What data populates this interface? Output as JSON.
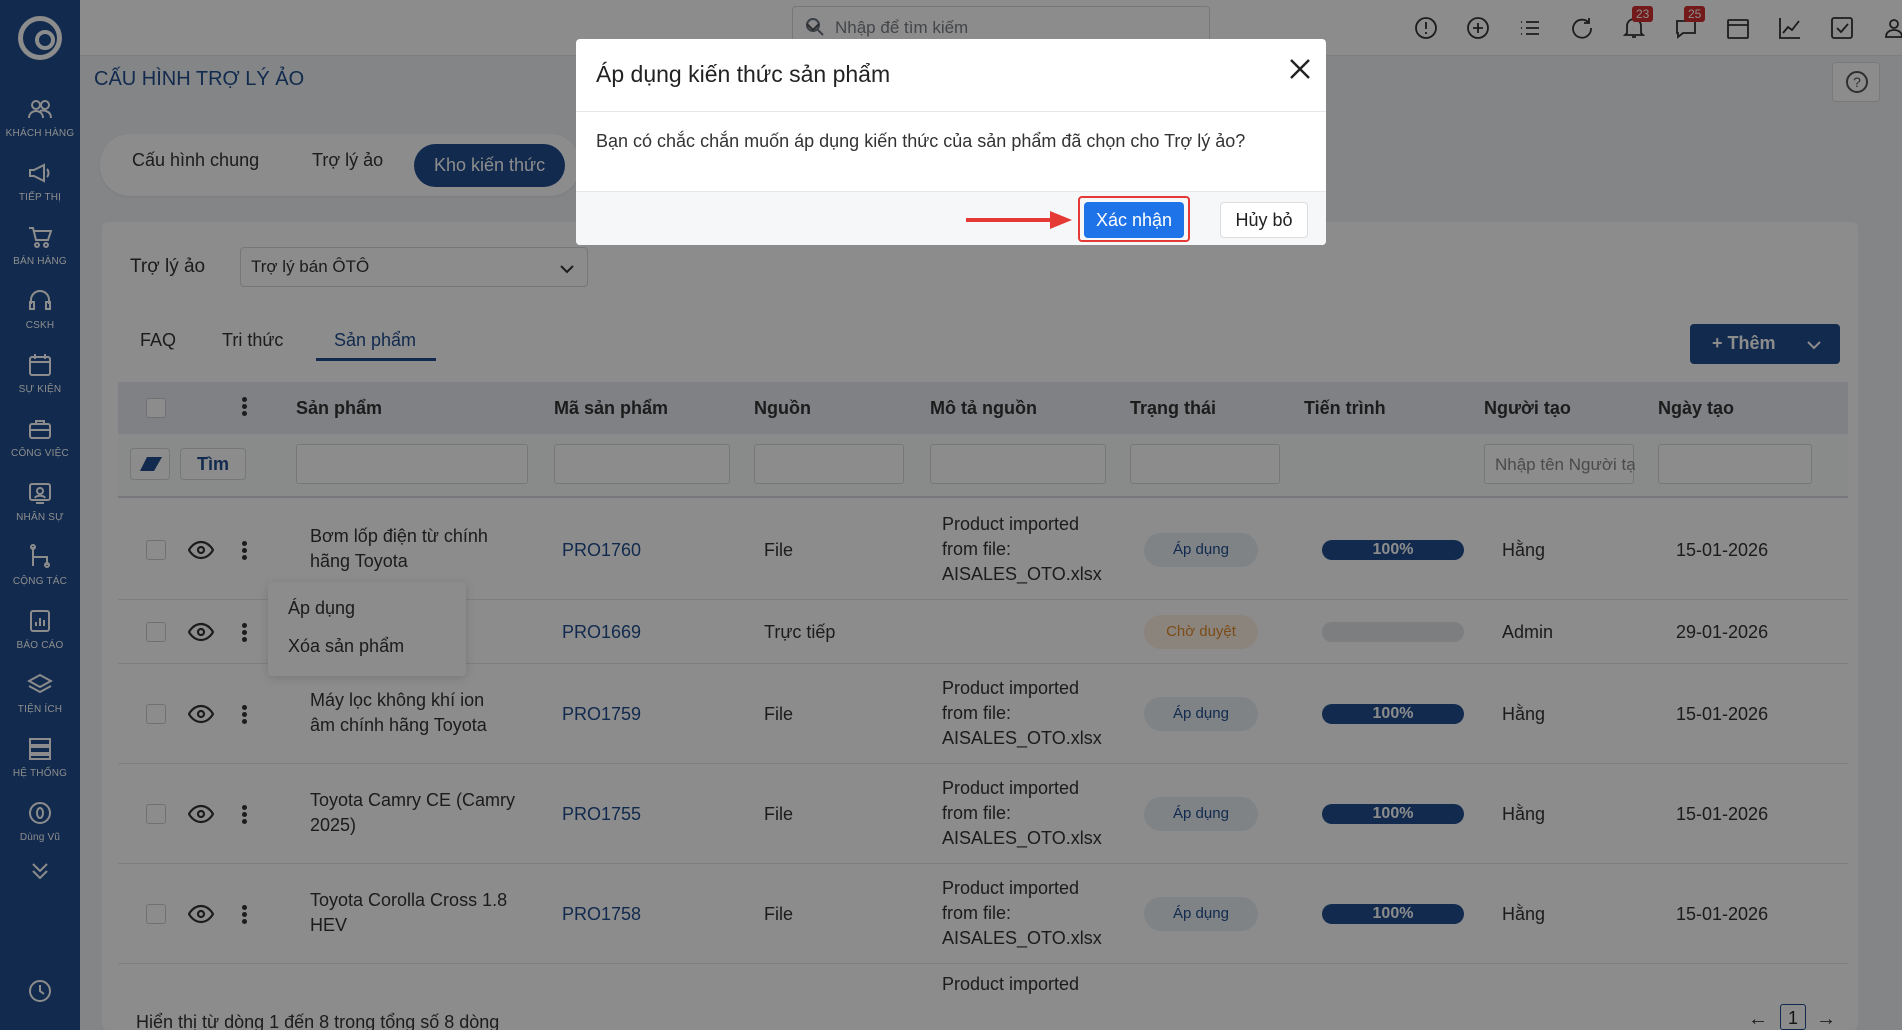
{
  "sidebar": {
    "items": [
      {
        "label": "KHÁCH HÀNG",
        "icon": "users-icon"
      },
      {
        "label": "TIẾP THỊ",
        "icon": "megaphone-icon"
      },
      {
        "label": "BÁN HÀNG",
        "icon": "cart-icon"
      },
      {
        "label": "CSKH",
        "icon": "headset-icon"
      },
      {
        "label": "SỰ KIỆN",
        "icon": "calendar-icon"
      },
      {
        "label": "CÔNG VIỆC",
        "icon": "briefcase-icon"
      },
      {
        "label": "NHÂN SỰ",
        "icon": "id-card-icon"
      },
      {
        "label": "CỘNG TÁC",
        "icon": "network-icon"
      },
      {
        "label": "BÁO CÁO",
        "icon": "report-icon"
      },
      {
        "label": "TIỆN ÍCH",
        "icon": "layers-icon"
      },
      {
        "label": "HỆ THỐNG",
        "icon": "server-icon"
      },
      {
        "label": "Dùng Vũ",
        "icon": "user-zero-icon"
      }
    ]
  },
  "topbar": {
    "search_placeholder": "Nhập để tìm kiếm",
    "notifications_badge": "23",
    "messages_badge": "25"
  },
  "page": {
    "title": "CẤU HÌNH TRỢ LÝ ẢO",
    "help": "?"
  },
  "tabs": [
    "Cấu hình chung",
    "Trợ lý ảo",
    "Kho kiến thức"
  ],
  "assistant": {
    "label": "Trợ lý ảo",
    "selected": "Trợ lý bán ÔTÔ"
  },
  "subtabs": [
    "FAQ",
    "Tri thức",
    "Sản phẩm"
  ],
  "add_button": "Thêm",
  "table": {
    "headers": [
      "Sản phẩm",
      "Mã sản phẩm",
      "Nguồn",
      "Mô tả nguồn",
      "Trạng thái",
      "Tiến trình",
      "Người tạo",
      "Ngày tạo"
    ],
    "find_button": "Tìm",
    "creator_placeholder": "Nhập tên Người tạo",
    "rows": [
      {
        "product_line1": "Bơm lốp điện từ chính",
        "product_line2": "hãng Toyota",
        "code": "PRO1760",
        "source": "File",
        "desc1": "Product imported",
        "desc2": "from file:",
        "desc3": "AISALES_OTO.xlsx",
        "status": "Áp dụng",
        "progress": 100,
        "progress_label": "100%",
        "creator": "Hằng",
        "date": "15-01-2026"
      },
      {
        "product_line1": "",
        "product_line2": "",
        "code": "PRO1669",
        "source": "Trực tiếp",
        "desc1": "",
        "desc2": "",
        "desc3": "",
        "status": "Chờ duyệt",
        "progress": 0,
        "progress_label": "",
        "creator": "Admin",
        "date": "29-01-2026"
      },
      {
        "product_line1": "Máy lọc không khí ion",
        "product_line2": "âm chính hãng Toyota",
        "code": "PRO1759",
        "source": "File",
        "desc1": "Product imported",
        "desc2": "from file:",
        "desc3": "AISALES_OTO.xlsx",
        "status": "Áp dụng",
        "progress": 100,
        "progress_label": "100%",
        "creator": "Hằng",
        "date": "15-01-2026"
      },
      {
        "product_line1": "Toyota Camry CE (Camry",
        "product_line2": "2025)",
        "code": "PRO1755",
        "source": "File",
        "desc1": "Product imported",
        "desc2": "from file:",
        "desc3": "AISALES_OTO.xlsx",
        "status": "Áp dụng",
        "progress": 100,
        "progress_label": "100%",
        "creator": "Hằng",
        "date": "15-01-2026"
      },
      {
        "product_line1": "Toyota Corolla Cross 1.8",
        "product_line2": "HEV",
        "code": "PRO1758",
        "source": "File",
        "desc1": "Product imported",
        "desc2": "from file:",
        "desc3": "AISALES_OTO.xlsx",
        "status": "Áp dụng",
        "progress": 100,
        "progress_label": "100%",
        "creator": "Hằng",
        "date": "15-01-2026"
      }
    ],
    "partial_row_desc": "Product imported"
  },
  "context_menu": [
    "Áp dụng",
    "Xóa sản phẩm"
  ],
  "footer": {
    "summary": "Hiển thị từ dòng 1 đến 8 trong tổng số 8 dòng",
    "page": "1",
    "prev": "←",
    "next": "→"
  },
  "modal": {
    "title": "Áp dụng kiến thức sản phẩm",
    "body": "Bạn có chắc chắn muốn áp dụng kiến thức của sản phẩm đã chọn cho Trợ lý ảo?",
    "confirm": "Xác nhận",
    "cancel": "Hủy bỏ"
  },
  "colors": {
    "primary": "#1f4d8f",
    "confirm": "#1e73e8",
    "highlight": "#e53935"
  }
}
